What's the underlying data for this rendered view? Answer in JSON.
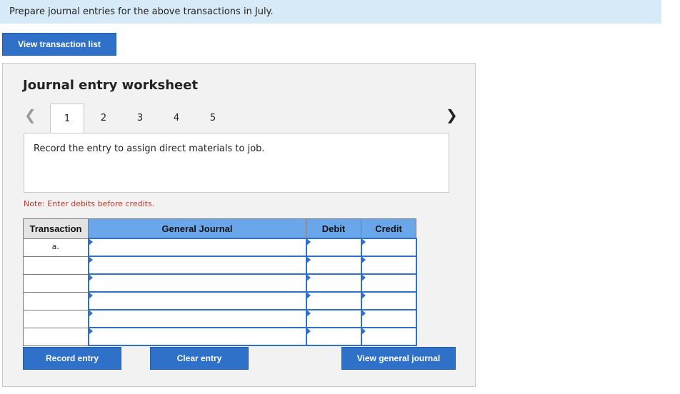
{
  "instruction": "Prepare journal entries for the above transactions in July.",
  "view_transactions_label": "View transaction list",
  "worksheet": {
    "title": "Journal entry worksheet",
    "tabs": [
      "1",
      "2",
      "3",
      "4",
      "5"
    ],
    "active_tab": "1",
    "description": "Record the entry to assign direct materials to job.",
    "note": "Note: Enter debits before credits."
  },
  "journal": {
    "headers": [
      "Transaction",
      "General Journal",
      "Debit",
      "Credit"
    ],
    "rows": [
      {
        "transaction": "a.",
        "account": "",
        "debit": "",
        "credit": ""
      },
      {
        "transaction": "",
        "account": "",
        "debit": "",
        "credit": ""
      },
      {
        "transaction": "",
        "account": "",
        "debit": "",
        "credit": ""
      },
      {
        "transaction": "",
        "account": "",
        "debit": "",
        "credit": ""
      },
      {
        "transaction": "",
        "account": "",
        "debit": "",
        "credit": ""
      },
      {
        "transaction": "",
        "account": "",
        "debit": "",
        "credit": ""
      }
    ]
  },
  "buttons": {
    "record": "Record entry",
    "clear": "Clear entry",
    "view_journal": "View general journal"
  },
  "icons": {
    "prev": "chevron-left-icon",
    "next": "chevron-right-icon"
  },
  "colors": {
    "accent": "#2f71c9",
    "header_blue": "#6aa7ea",
    "note_red": "#c0392b",
    "instruction_bg": "#d6eaf8"
  }
}
